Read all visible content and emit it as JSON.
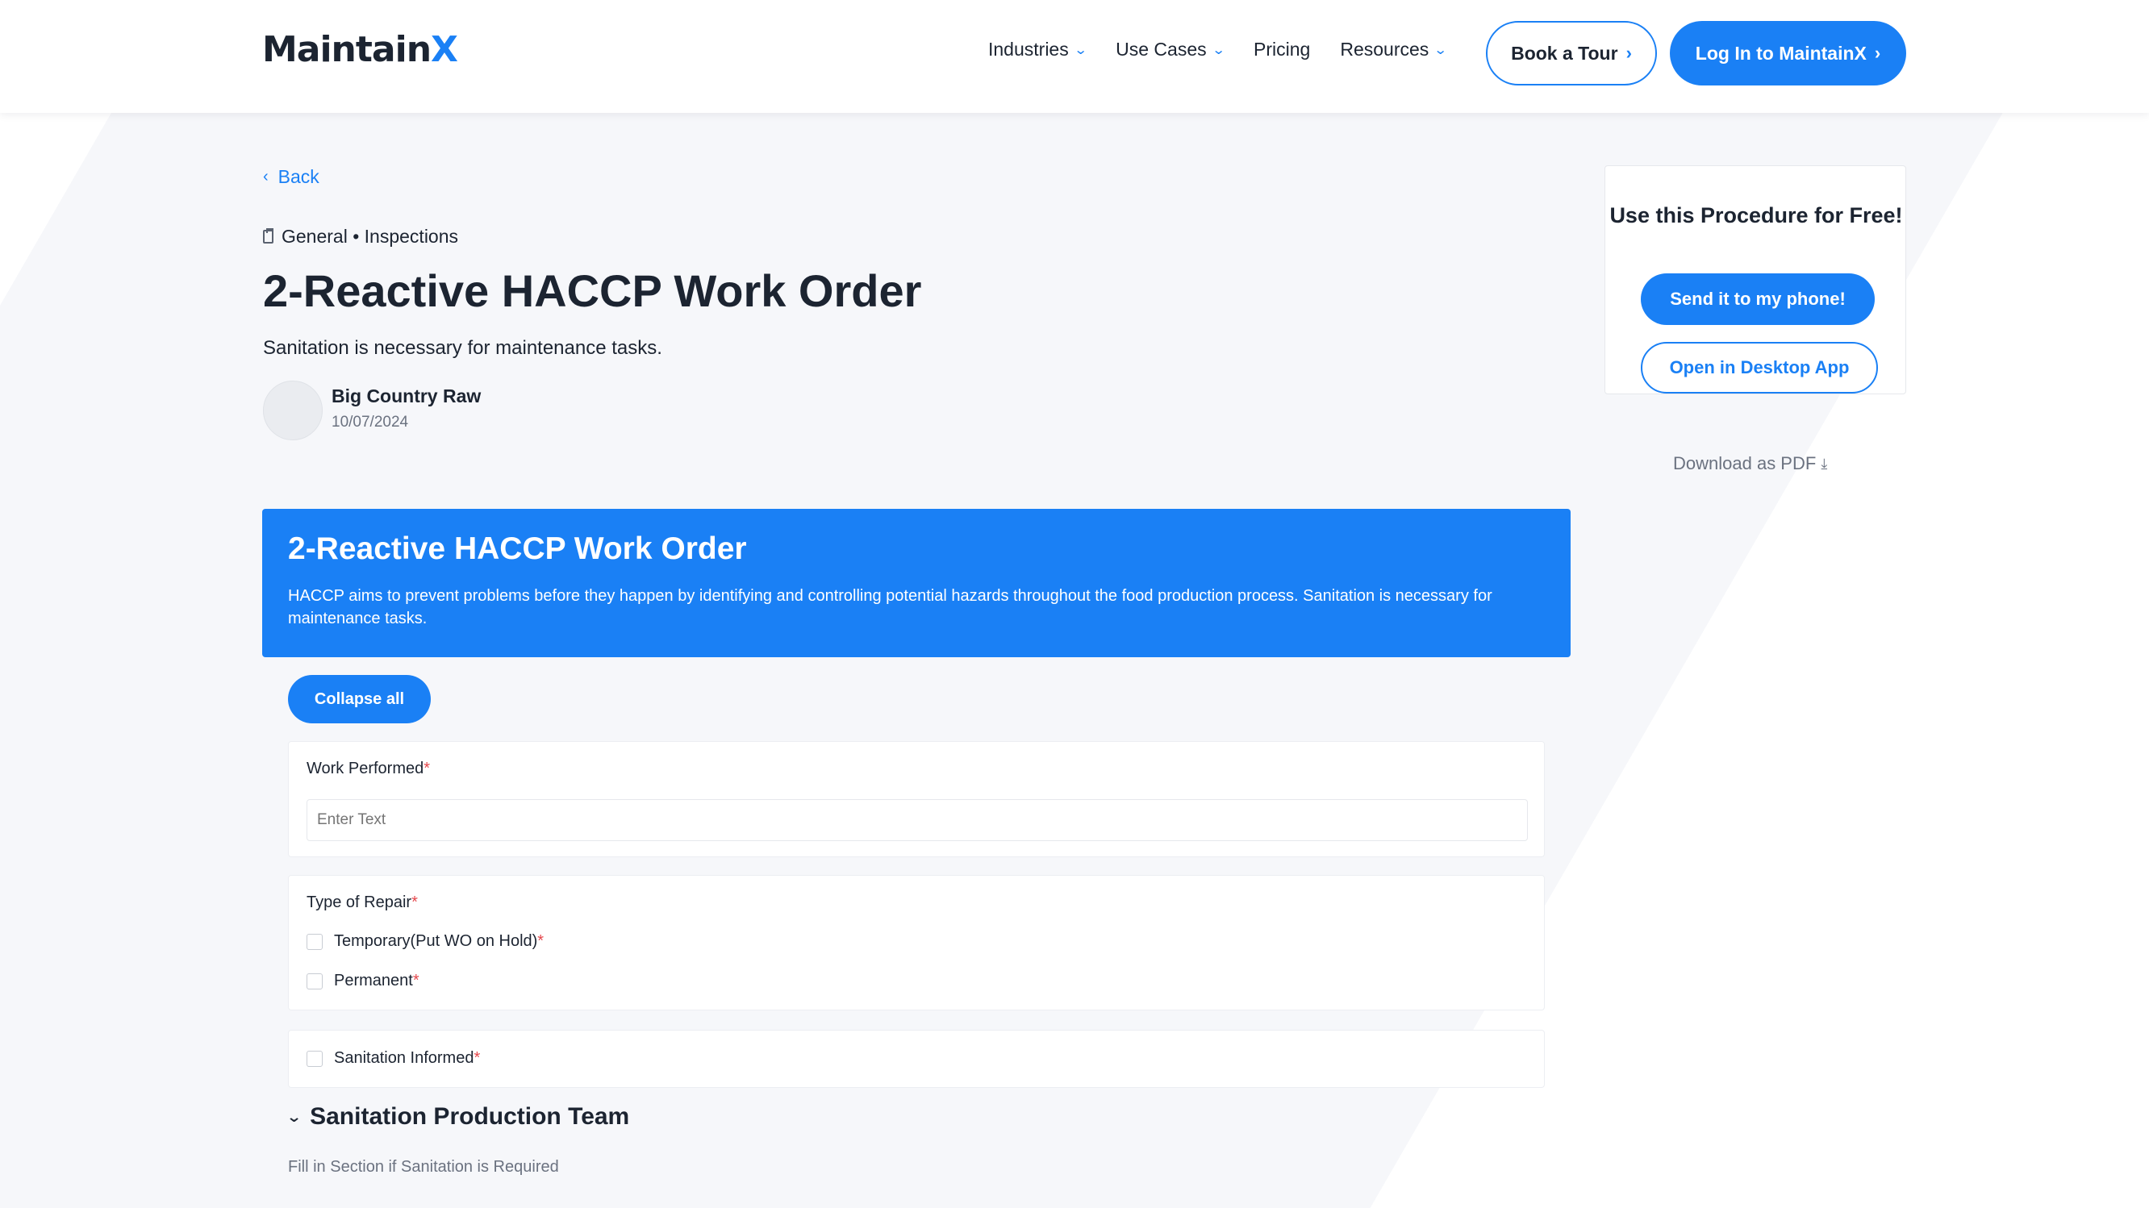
{
  "header": {
    "logo_text": "Maintain",
    "logo_accent": "X",
    "nav": [
      {
        "label": "Industries",
        "has_dropdown": true
      },
      {
        "label": "Use Cases",
        "has_dropdown": true
      },
      {
        "label": "Pricing",
        "has_dropdown": false
      },
      {
        "label": "Resources",
        "has_dropdown": true
      }
    ],
    "tour_button": "Book a Tour",
    "login_button": "Log In to MaintainX"
  },
  "procedure": {
    "back_label": "Back",
    "breadcrumb": "General • Inspections",
    "title": "2-Reactive HACCP Work Order",
    "description": "Sanitation is necessary for maintenance tasks.",
    "author": {
      "name": "Big Country Raw",
      "date": "10/07/2024"
    }
  },
  "banner": {
    "title": "2-Reactive HACCP Work Order",
    "description": "HACCP aims to prevent problems before they happen by identifying and controlling potential hazards throughout the food production process. Sanitation is necessary for maintenance tasks."
  },
  "form": {
    "collapse_label": "Collapse all",
    "work_performed": {
      "label": "Work Performed",
      "required_mark": "*",
      "placeholder": "Enter Text"
    },
    "type_of_repair": {
      "label": "Type of Repair",
      "required_mark": "*",
      "options": [
        {
          "label": "Temporary(Put WO on Hold)",
          "required_mark": "*",
          "checked": false
        },
        {
          "label": "Permanent",
          "required_mark": "*",
          "checked": false
        }
      ]
    },
    "sanitation_informed": {
      "label": "Sanitation Informed",
      "required_mark": "*",
      "checked": false
    },
    "section": {
      "title": "Sanitation Production Team",
      "note": "Fill in Section if Sanitation is Required"
    }
  },
  "sidebar": {
    "title": "Use this Procedure for Free!",
    "send_button": "Send it to my phone!",
    "desktop_button": "Open in Desktop App",
    "download_label": "Download as PDF"
  },
  "colors": {
    "accent": "#1a80f5",
    "required": "#e5484d",
    "text": "#1c2431"
  }
}
